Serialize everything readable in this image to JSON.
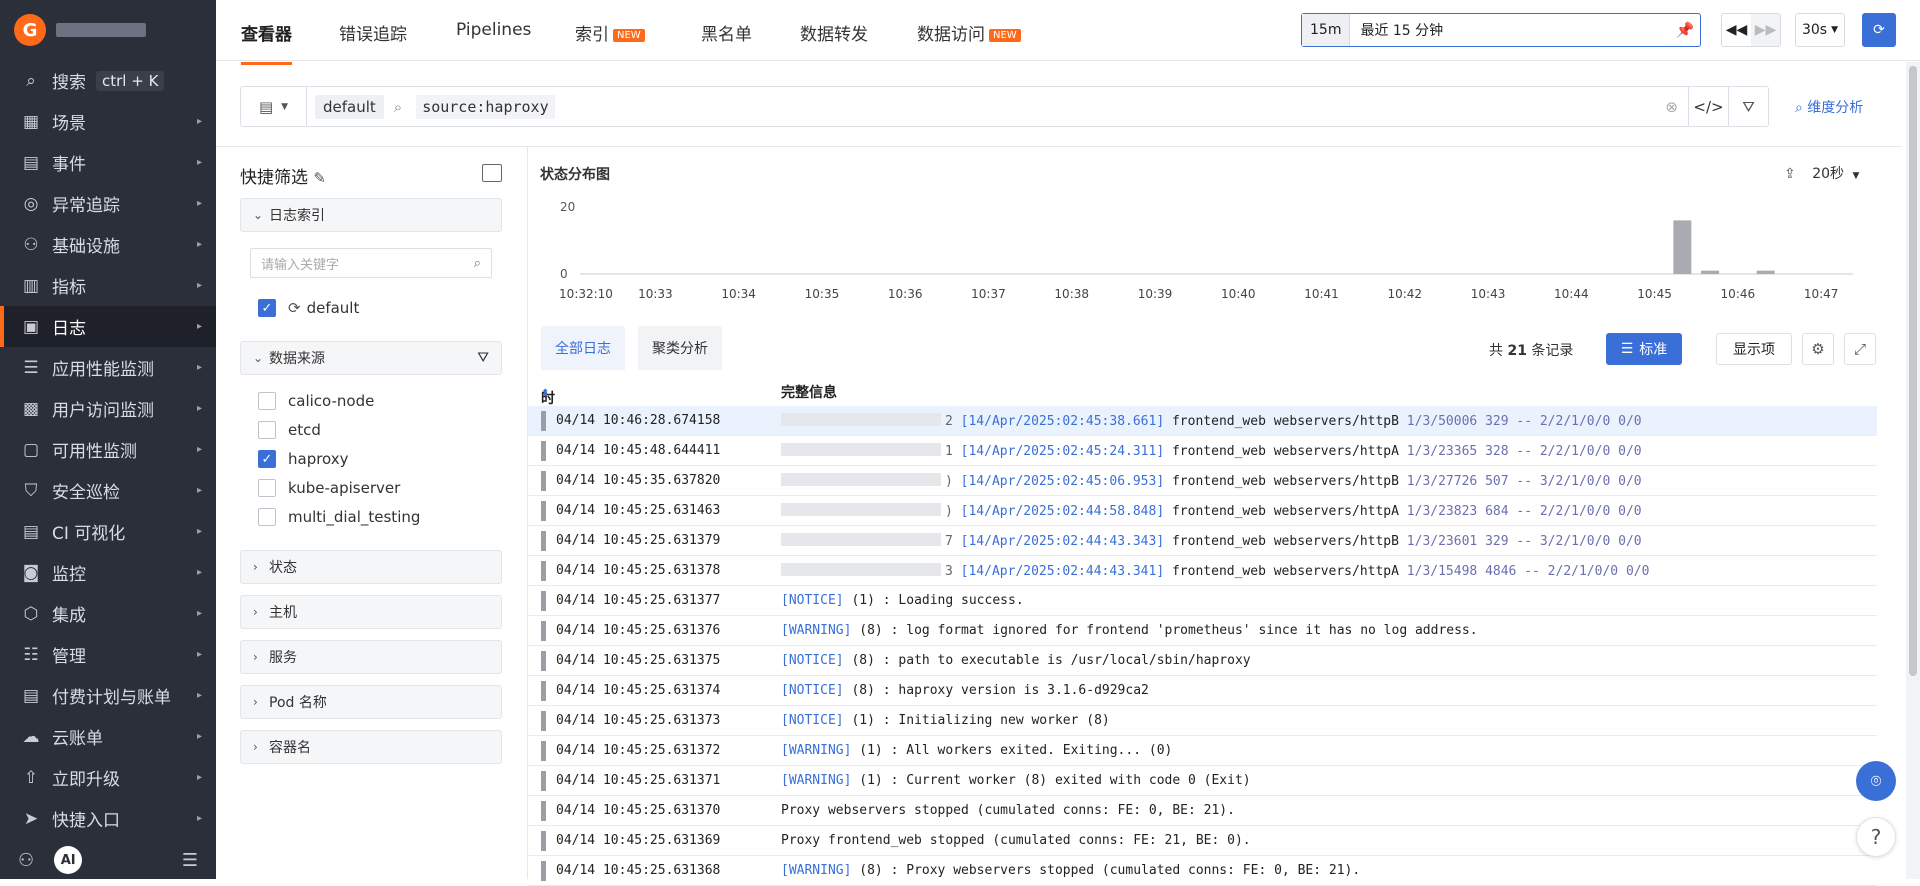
{
  "sidebar": {
    "items": [
      {
        "label": "搜索",
        "icon": "search-icon",
        "glyph": "⌕",
        "kbd": "ctrl + K"
      },
      {
        "label": "场景",
        "icon": "dashboard-icon",
        "glyph": "▦"
      },
      {
        "label": "事件",
        "icon": "calendar-icon",
        "glyph": "▤"
      },
      {
        "label": "异常追踪",
        "icon": "tracking-icon",
        "glyph": "◎"
      },
      {
        "label": "基础设施",
        "icon": "infrastructure-icon",
        "glyph": "⚇"
      },
      {
        "label": "指标",
        "icon": "metrics-icon",
        "glyph": "▥"
      },
      {
        "label": "日志",
        "icon": "log-icon",
        "glyph": "▣"
      },
      {
        "label": "应用性能监测",
        "icon": "apm-icon",
        "glyph": "☰"
      },
      {
        "label": "用户访问监测",
        "icon": "rum-icon",
        "glyph": "▩"
      },
      {
        "label": "可用性监测",
        "icon": "availability-icon",
        "glyph": "▢"
      },
      {
        "label": "安全巡检",
        "icon": "shield-icon",
        "glyph": "⛉"
      },
      {
        "label": "CI 可视化",
        "icon": "ci-icon",
        "glyph": "▤"
      },
      {
        "label": "监控",
        "icon": "monitor-icon",
        "glyph": "◙"
      },
      {
        "label": "集成",
        "icon": "integration-icon",
        "glyph": "⬡"
      },
      {
        "label": "管理",
        "icon": "settings-icon",
        "glyph": "☷"
      },
      {
        "label": "付费计划与账单",
        "icon": "billing-icon",
        "glyph": "▤"
      },
      {
        "label": "云账单",
        "icon": "cloud-icon",
        "glyph": "☁"
      },
      {
        "label": "立即升级",
        "icon": "upgrade-icon",
        "glyph": "⇧"
      },
      {
        "label": "快捷入口",
        "icon": "send-icon",
        "glyph": "➤"
      }
    ],
    "bottom": {
      "robot": "AI"
    }
  },
  "topnav": {
    "tabs": [
      {
        "label": "查看器",
        "new": ""
      },
      {
        "label": "错误追踪",
        "new": ""
      },
      {
        "label": "Pipelines",
        "new": ""
      },
      {
        "label": "索引",
        "new": "NEW"
      },
      {
        "label": "黑名单",
        "new": ""
      },
      {
        "label": "数据转发",
        "new": ""
      },
      {
        "label": "数据访问",
        "new": "NEW"
      }
    ],
    "time_short": "15m",
    "time_text": "最近 15 分钟",
    "refresh": "30s"
  },
  "search": {
    "index": "default",
    "source_key": "source",
    "source_value": "haproxy",
    "dim_link": "维度分析"
  },
  "quick_filter": {
    "title": "快捷筛选",
    "index_group": "日志索引",
    "keyword_placeholder": "请输入关键字",
    "index_option": "default",
    "source_group": "数据来源",
    "sources": [
      {
        "label": "calico-node",
        "checked": false
      },
      {
        "label": "etcd",
        "checked": false
      },
      {
        "label": "haproxy",
        "checked": true
      },
      {
        "label": "kube-apiserver",
        "checked": false
      },
      {
        "label": "multi_dial_testing",
        "checked": false
      }
    ],
    "groups": [
      "状态",
      "主机",
      "服务",
      "Pod 名称",
      "容器名"
    ]
  },
  "chart_data": {
    "type": "bar",
    "title": "状态分布图",
    "interval": "20秒",
    "ylim": [
      0,
      20
    ],
    "y_ticks": [
      "20",
      "0"
    ],
    "x_ticks": [
      "10:32:10",
      "10:33",
      "10:34",
      "10:35",
      "10:36",
      "10:37",
      "10:38",
      "10:39",
      "10:40",
      "10:41",
      "10:42",
      "10:43",
      "10:44",
      "10:45",
      "10:46",
      "10:47"
    ],
    "bars": [
      {
        "x": "10:45:20",
        "value": 16
      },
      {
        "x": "10:45:40",
        "value": 1
      },
      {
        "x": "10:46:20",
        "value": 1
      }
    ]
  },
  "log_tabs": {
    "all": "全部日志",
    "cluster": "聚类分析"
  },
  "records": {
    "prefix": "共",
    "count": "21",
    "suffix": "条记录"
  },
  "toolbar": {
    "standard": "标准",
    "columns": "显示项"
  },
  "table": {
    "col_time": "时间",
    "col_msg": "完整信息",
    "rows": [
      {
        "time": "04/14 10:46:28.674158",
        "ip_suffix": "2",
        "stamp": "[14/Apr/2025:02:45:38.661]",
        "mid": "frontend_web webservers/httpB",
        "tail": "1/3/50006 329 -- 2/2/1/0/0 0/0"
      },
      {
        "time": "04/14 10:45:48.644411",
        "ip_suffix": "1",
        "stamp": "[14/Apr/2025:02:45:24.311]",
        "mid": "frontend_web webservers/httpA",
        "tail": "1/3/23365 328 -- 2/2/1/0/0 0/0"
      },
      {
        "time": "04/14 10:45:35.637820",
        "ip_suffix": ")",
        "stamp": "[14/Apr/2025:02:45:06.953]",
        "mid": "frontend_web webservers/httpB",
        "tail": "1/3/27726 507 -- 3/2/1/0/0 0/0"
      },
      {
        "time": "04/14 10:45:25.631463",
        "ip_suffix": ")",
        "stamp": "[14/Apr/2025:02:44:58.848]",
        "mid": "frontend_web webservers/httpA",
        "tail": "1/3/23823 684 -- 2/2/1/0/0 0/0"
      },
      {
        "time": "04/14 10:45:25.631379",
        "ip_suffix": "7",
        "stamp": "[14/Apr/2025:02:44:43.343]",
        "mid": "frontend_web webservers/httpB",
        "tail": "1/3/23601 329 -- 3/2/1/0/0 0/0"
      },
      {
        "time": "04/14 10:45:25.631378",
        "ip_suffix": "3",
        "stamp": "[14/Apr/2025:02:44:43.341]",
        "mid": "frontend_web webservers/httpA",
        "tail": "1/3/15498 4846 -- 2/2/1/0/0 0/0"
      },
      {
        "time": "04/14 10:45:25.631377",
        "level": "[NOTICE]",
        "msg": "(1) : Loading success."
      },
      {
        "time": "04/14 10:45:25.631376",
        "level": "[WARNING]",
        "msg": "(8) : log format ignored for frontend 'prometheus' since it has no log address."
      },
      {
        "time": "04/14 10:45:25.631375",
        "level": "[NOTICE]",
        "msg": "(8) : path to executable is /usr/local/sbin/haproxy"
      },
      {
        "time": "04/14 10:45:25.631374",
        "level": "[NOTICE]",
        "msg": "(8) : haproxy version is 3.1.6-d929ca2"
      },
      {
        "time": "04/14 10:45:25.631373",
        "level": "[NOTICE]",
        "msg": "(1) : Initializing new worker (8)"
      },
      {
        "time": "04/14 10:45:25.631372",
        "level": "[WARNING]",
        "msg": "(1) : All workers exited. Exiting... (0)"
      },
      {
        "time": "04/14 10:45:25.631371",
        "level": "[WARNING]",
        "msg": "(1) : Current worker (8) exited with code 0 (Exit)"
      },
      {
        "time": "04/14 10:45:25.631370",
        "level": "",
        "msg": "Proxy webservers stopped (cumulated conns: FE: 0, BE: 21)."
      },
      {
        "time": "04/14 10:45:25.631369",
        "level": "",
        "msg": "Proxy frontend_web stopped (cumulated conns: FE: 21, BE: 0)."
      },
      {
        "time": "04/14 10:45:25.631368",
        "level": "[WARNING]",
        "msg": "(8) : Proxy webservers stopped (cumulated conns: FE: 0, BE: 21)."
      }
    ]
  },
  "colors": {
    "accent": "#ff6a1a",
    "primary": "#3a6fd8",
    "bar": "#a9abb0"
  }
}
